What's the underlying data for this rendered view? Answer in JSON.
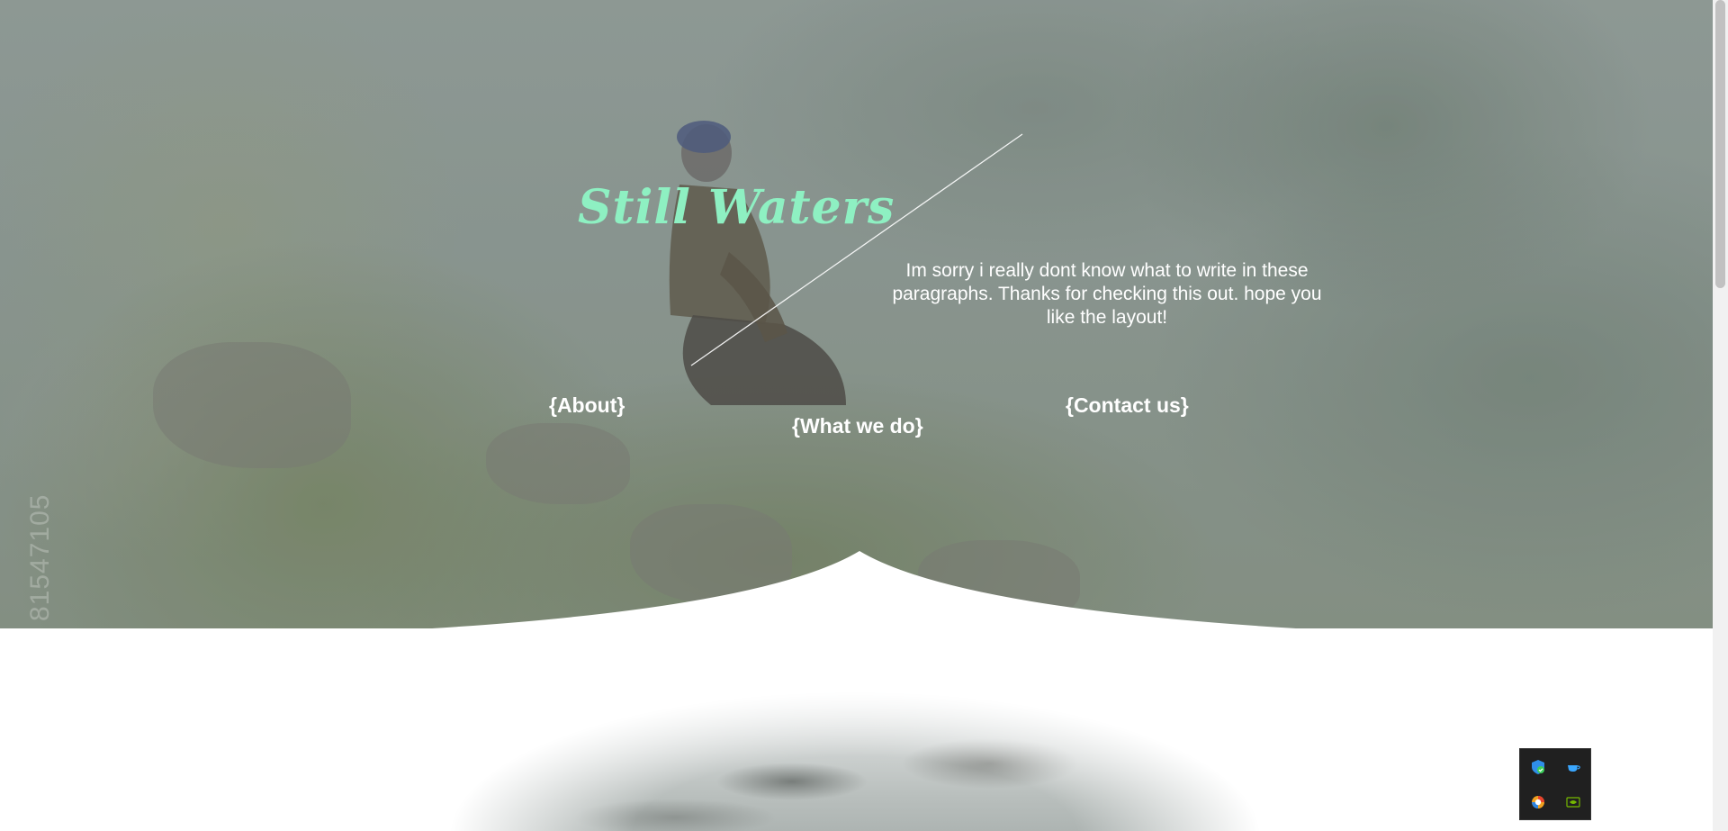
{
  "site": {
    "title": "Still Waters",
    "intro": "Im sorry i really dont know what to write in these paragraphs. Thanks for checking this out. hope you like the layout!",
    "watermark": "81547105"
  },
  "nav": {
    "about": "{About}",
    "what_we_do": "{What we do}",
    "contact": "{Contact us}"
  },
  "colors": {
    "title": "#8ef0c2",
    "text": "#ffffff"
  },
  "tray": {
    "icons": [
      "shield-check-icon",
      "cup-icon",
      "color-wheel-icon",
      "nvidia-icon"
    ]
  }
}
